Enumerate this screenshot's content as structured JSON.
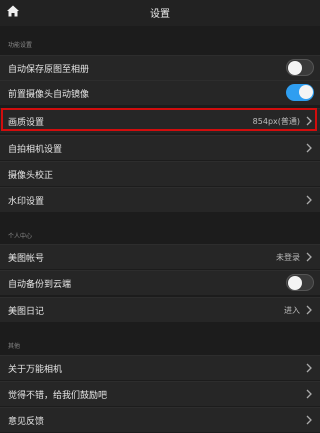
{
  "header": {
    "title": "设置",
    "home_icon": "home-icon"
  },
  "sections": {
    "function": "功能设置",
    "personal": "个人中心",
    "other": "其他"
  },
  "rows": {
    "auto_save": {
      "label": "自动保存原图至相册",
      "toggle": "off"
    },
    "front_mirror": {
      "label": "前置摄像头自动镜像",
      "toggle": "on"
    },
    "quality": {
      "label": "画质设置",
      "value": "854px(普通)"
    },
    "selfie": {
      "label": "自拍相机设置"
    },
    "calibration": {
      "label": "摄像头校正"
    },
    "watermark": {
      "label": "水印设置"
    },
    "account": {
      "label": "美图帐号",
      "value": "未登录"
    },
    "cloud_backup": {
      "label": "自动备份到云端",
      "toggle": "off"
    },
    "diary": {
      "label": "美图日记",
      "value": "进入"
    },
    "about": {
      "label": "关于万能相机"
    },
    "rate": {
      "label": "觉得不错，给我们鼓励吧"
    },
    "feedback": {
      "label": "意见反馈"
    }
  },
  "colors": {
    "background": "#1c1c1c",
    "row": "#262626",
    "toggle_on": "#2f9ef0",
    "highlight": "#d10d0d"
  }
}
